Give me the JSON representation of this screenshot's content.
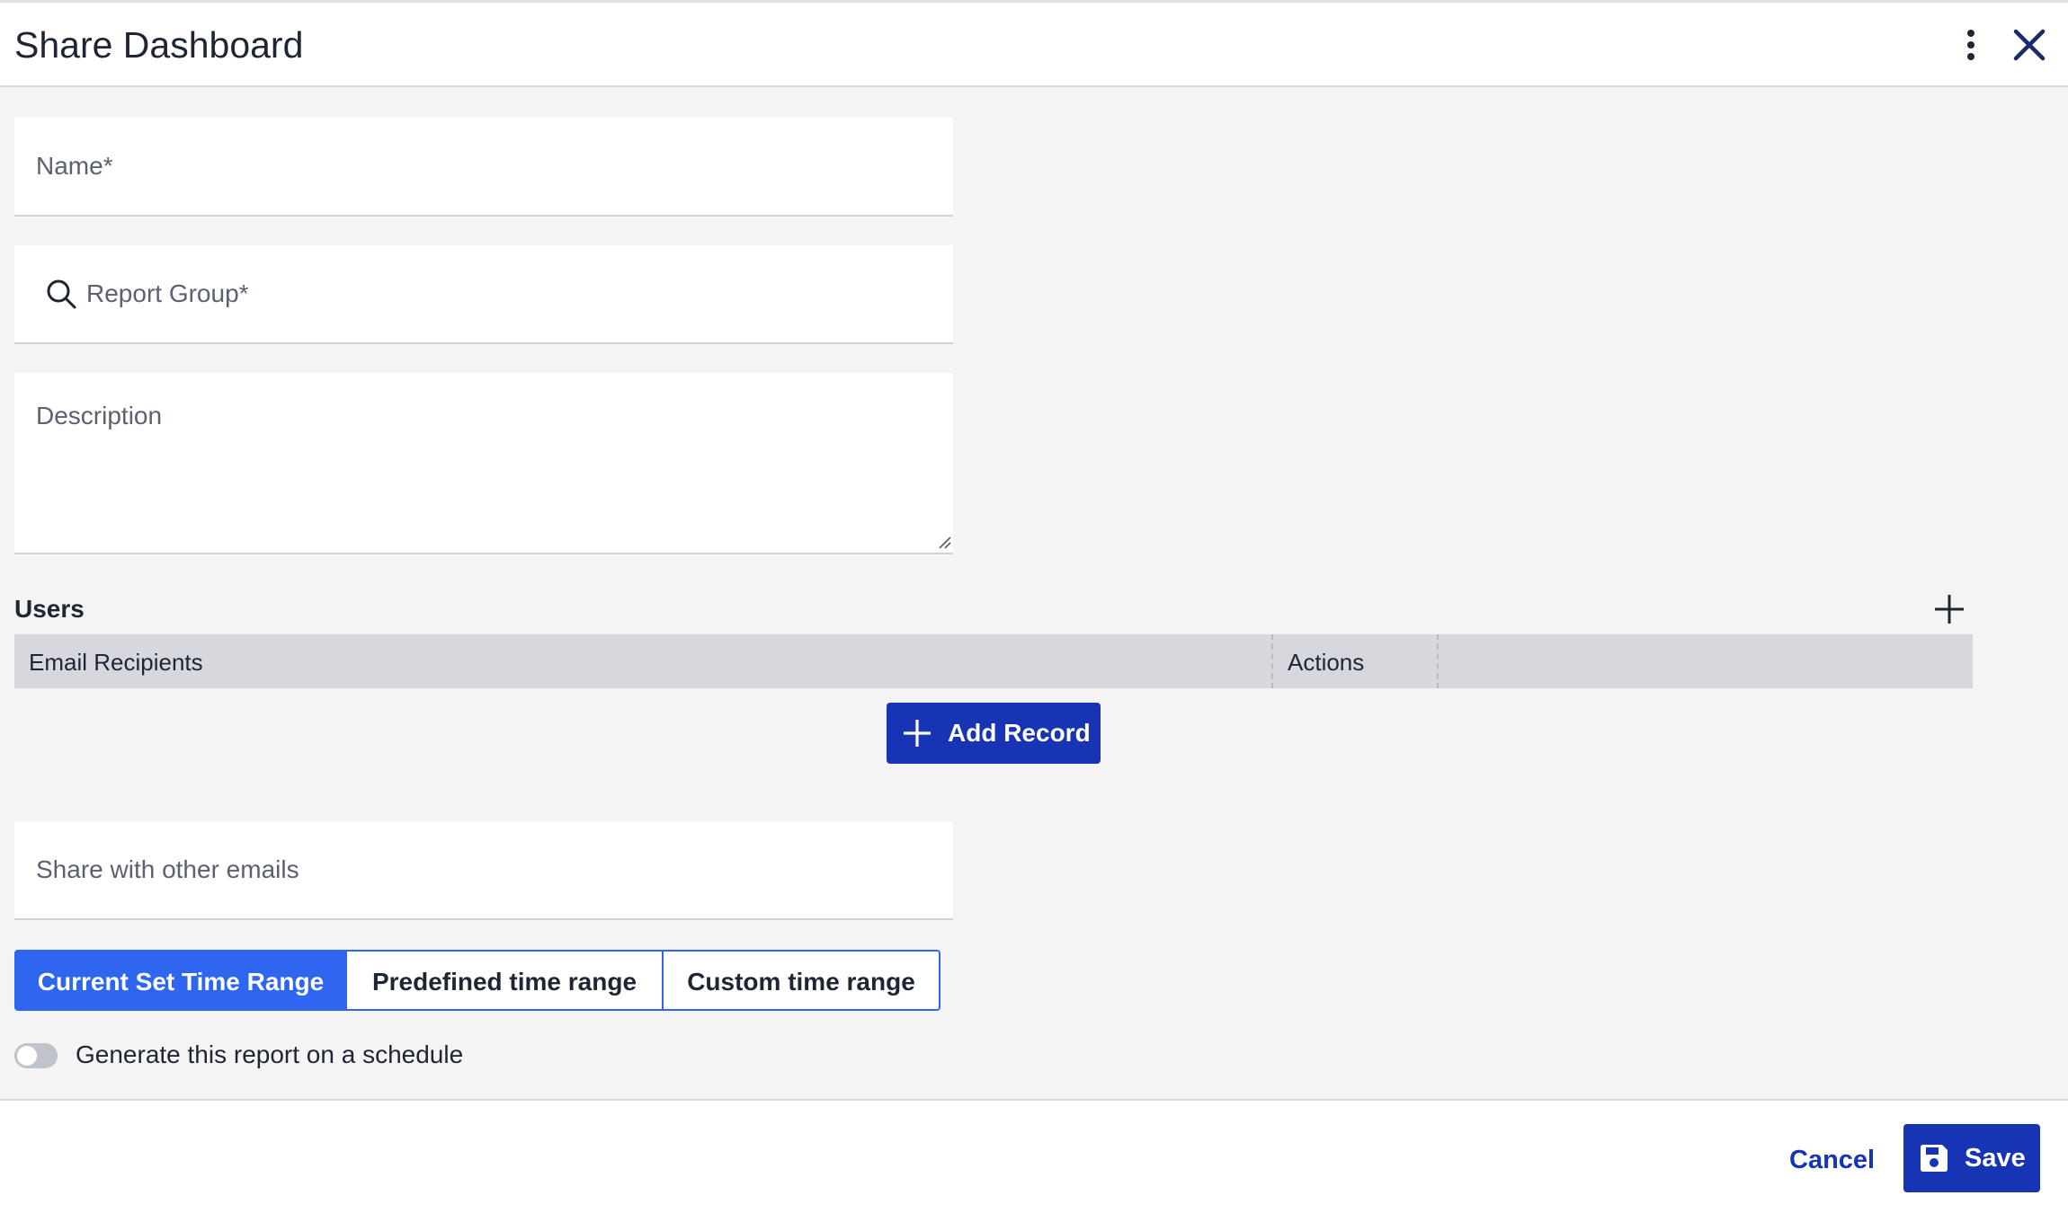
{
  "dialog": {
    "title": "Share Dashboard",
    "icons": {
      "menu": "kebab-vertical-icon",
      "close": "close-x-icon"
    }
  },
  "form": {
    "name": {
      "placeholder": "Name*",
      "value": ""
    },
    "report_group": {
      "placeholder": "Report Group*",
      "value": "",
      "icon": "search-icon"
    },
    "description": {
      "placeholder": "Description",
      "value": ""
    },
    "share_emails": {
      "placeholder": "Share with other emails",
      "value": ""
    }
  },
  "users": {
    "label": "Users",
    "columns": [
      "Email Recipients",
      "Actions"
    ],
    "rows": [],
    "add_record_label": "Add Record"
  },
  "time_range": {
    "options": [
      "Current Set Time Range",
      "Predefined time range",
      "Custom time range"
    ],
    "selected": "Current Set Time Range"
  },
  "schedule": {
    "label": "Generate this report on a schedule",
    "enabled": false
  },
  "footer": {
    "cancel_label": "Cancel",
    "save_label": "Save"
  },
  "colors": {
    "primary": "#1734b5",
    "selected_segment": "#2e66f0",
    "background": "#f4f4f4"
  }
}
